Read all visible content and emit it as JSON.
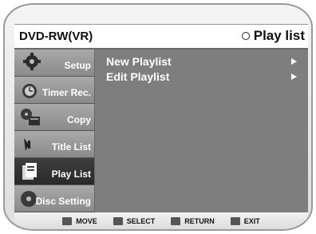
{
  "header": {
    "device": "DVD-RW(VR)",
    "mode": "Play list"
  },
  "sidebar": {
    "items": [
      {
        "label": "Setup",
        "icon": "gear-icon",
        "active": false
      },
      {
        "label": "Timer Rec.",
        "icon": "timer-icon",
        "active": false
      },
      {
        "label": "Copy",
        "icon": "copy-icon",
        "active": false
      },
      {
        "label": "Title List",
        "icon": "title-list-icon",
        "active": false
      },
      {
        "label": "Play List",
        "icon": "play-list-icon",
        "active": true
      },
      {
        "label": "Disc Setting",
        "icon": "disc-icon",
        "active": false
      }
    ]
  },
  "menu": {
    "items": [
      {
        "label": "New Playlist"
      },
      {
        "label": "Edit Playlist"
      }
    ]
  },
  "footer": {
    "hints": [
      {
        "label": "MOVE",
        "icon": "move-icon"
      },
      {
        "label": "SELECT",
        "icon": "select-icon"
      },
      {
        "label": "RETURN",
        "icon": "return-icon"
      },
      {
        "label": "EXIT",
        "icon": "exit-icon"
      }
    ]
  },
  "colors": {
    "sidebar_active": "#2a2a2a",
    "sidebar_item": "#9a9a9a",
    "content_bg": "#7e7e7e",
    "text": "#ffffff"
  }
}
